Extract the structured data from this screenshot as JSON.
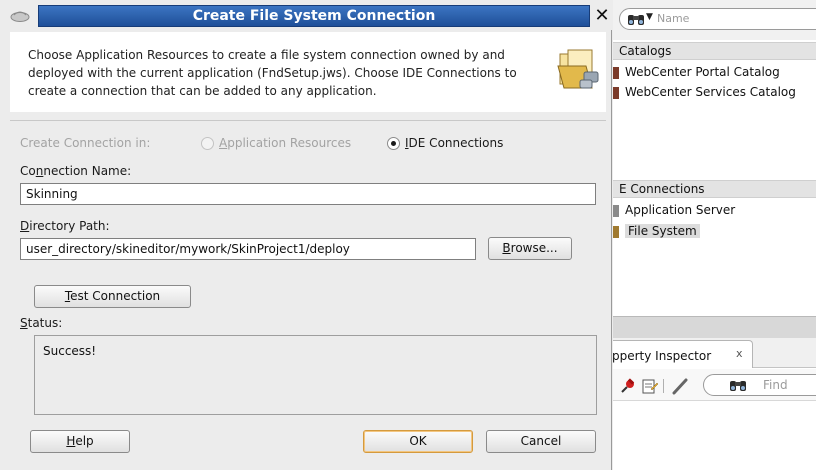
{
  "dialog": {
    "title": "Create File System Connection",
    "close_glyph": "✕",
    "description": "Choose Application Resources to create a file system connection owned by and deployed with the current application (FndSetup.jws). Choose IDE Connections to create a connection that can be added to any application.",
    "create_in_label": "Create Connection in:",
    "radio_app_resources": {
      "before": "",
      "mnemonic": "A",
      "after": "pplication Resources",
      "selected": false,
      "enabled": false
    },
    "radio_ide": {
      "before": "",
      "mnemonic": "I",
      "after": "DE Connections",
      "selected": true,
      "enabled": true
    },
    "connection_name_label": {
      "before": "Co",
      "mnemonic": "n",
      "after": "nection Name:"
    },
    "connection_name_value": "Skinning",
    "directory_path_label": {
      "before": "",
      "mnemonic": "D",
      "after": "irectory Path:"
    },
    "directory_path_value": "user_directory/skineditor/mywork/SkinProject1/deploy",
    "browse_button": {
      "before": "",
      "mnemonic": "B",
      "after": "rowse..."
    },
    "test_connection_button": {
      "before": "",
      "mnemonic": "T",
      "after": "est Connection"
    },
    "status_label": {
      "before": "",
      "mnemonic": "S",
      "after": "tatus:"
    },
    "status_text": "Success!",
    "help_button": {
      "before": "",
      "mnemonic": "H",
      "after": "elp"
    },
    "ok_button": "OK",
    "cancel_button": "Cancel"
  },
  "right_panel": {
    "search_placeholder": "Name",
    "catalogs_header": "Catalogs",
    "catalog_items": [
      "WebCenter Portal Catalog",
      "WebCenter Services Catalog"
    ],
    "connections_header": "E Connections",
    "connection_items": [
      "Application Server",
      "File System"
    ],
    "selected_connection": "File System",
    "inspector_tab_label": "pperty Inspector",
    "inspector_tab_close": "x",
    "find_placeholder": "Find",
    "icons": [
      "binoculars-icon",
      "pin-icon",
      "edit-icon",
      "pencil-icon",
      "binoculars-icon"
    ]
  },
  "colors": {
    "title_bar": "#2b5fab",
    "default_button_border": "#d49a3e",
    "window_bg": "#ececec"
  }
}
